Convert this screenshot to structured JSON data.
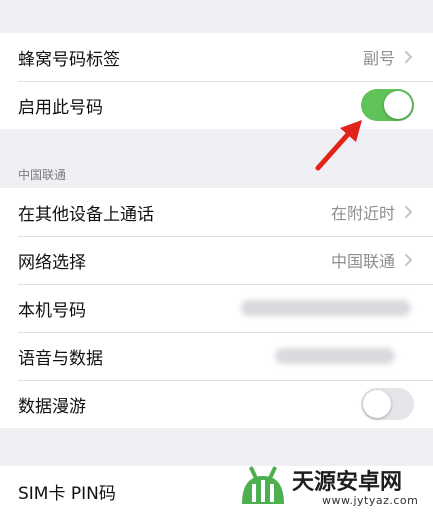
{
  "group1": {
    "row1": {
      "label": "蜂窝号码标签",
      "value": "副号"
    },
    "row2": {
      "label": "启用此号码",
      "toggle_on": true
    }
  },
  "section2": {
    "header": "中国联通",
    "rows": [
      {
        "label": "在其他设备上通话",
        "value": "在附近时"
      },
      {
        "label": "网络选择",
        "value": "中国联通"
      },
      {
        "label": "本机号码"
      },
      {
        "label": "语音与数据"
      },
      {
        "label": "数据漫游",
        "toggle_on": false
      }
    ]
  },
  "group3": {
    "row1": {
      "label": "SIM卡 PIN码"
    }
  },
  "watermark": {
    "name": "天源安卓网",
    "url": "www.jytyaz.com"
  },
  "colors": {
    "toggle_on": "#5fc35a",
    "toggle_off": "#e5e5ea",
    "arrow": "#e2231a",
    "background": "#efeff4"
  },
  "icons": {
    "chevron": "chevron-right-icon",
    "arrow": "red-arrow-icon"
  }
}
